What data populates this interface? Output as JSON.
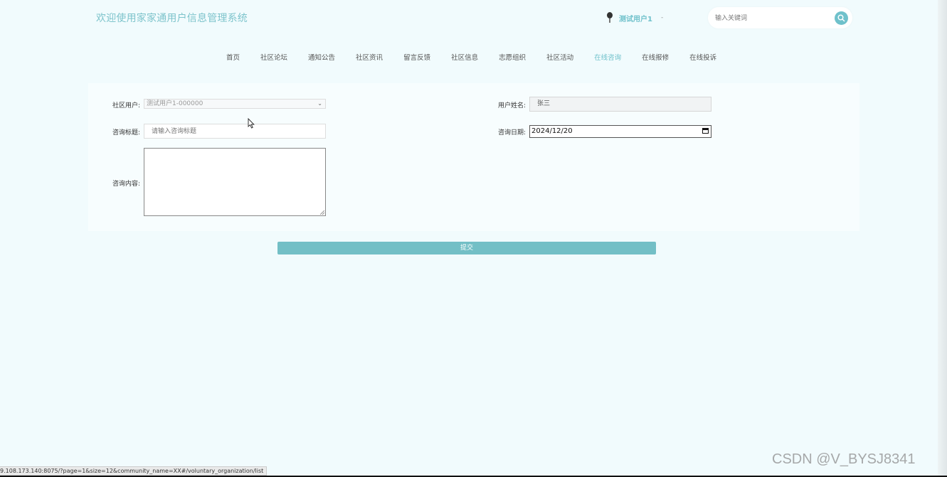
{
  "header": {
    "site_title": "欢迎使用家家通用户信息管理系统",
    "user_name": "测试用户1",
    "user_caret": "-",
    "search_placeholder": "输入关键词"
  },
  "nav": {
    "items": [
      {
        "label": "首页",
        "active": false
      },
      {
        "label": "社区论坛",
        "active": false
      },
      {
        "label": "通知公告",
        "active": false
      },
      {
        "label": "社区资讯",
        "active": false
      },
      {
        "label": "留言反馈",
        "active": false
      },
      {
        "label": "社区信息",
        "active": false
      },
      {
        "label": "志愿组织",
        "active": false
      },
      {
        "label": "社区活动",
        "active": false
      },
      {
        "label": "在线咨询",
        "active": true
      },
      {
        "label": "在线报修",
        "active": false
      },
      {
        "label": "在线投诉",
        "active": false
      }
    ]
  },
  "form": {
    "community_user_label": "社区用户:",
    "community_user_value": "测试用户1-000000",
    "user_name_label": "用户姓名:",
    "user_name_value": "张三",
    "title_label": "咨询标题:",
    "title_placeholder": "请输入咨询标题",
    "date_label": "咨询日期:",
    "date_value": "2024/12/20",
    "content_label": "咨询内容:",
    "submit_label": "提交"
  },
  "status_bar": {
    "url": "9.108.173.140:8075/?page=1&size=12&community_name=XX#/voluntary_organization/list"
  },
  "watermark": "CSDN @V_BYSJ8341",
  "colors": {
    "accent": "#6fc1cb",
    "button": "#73bfc6",
    "background": "#f1fbfd"
  }
}
